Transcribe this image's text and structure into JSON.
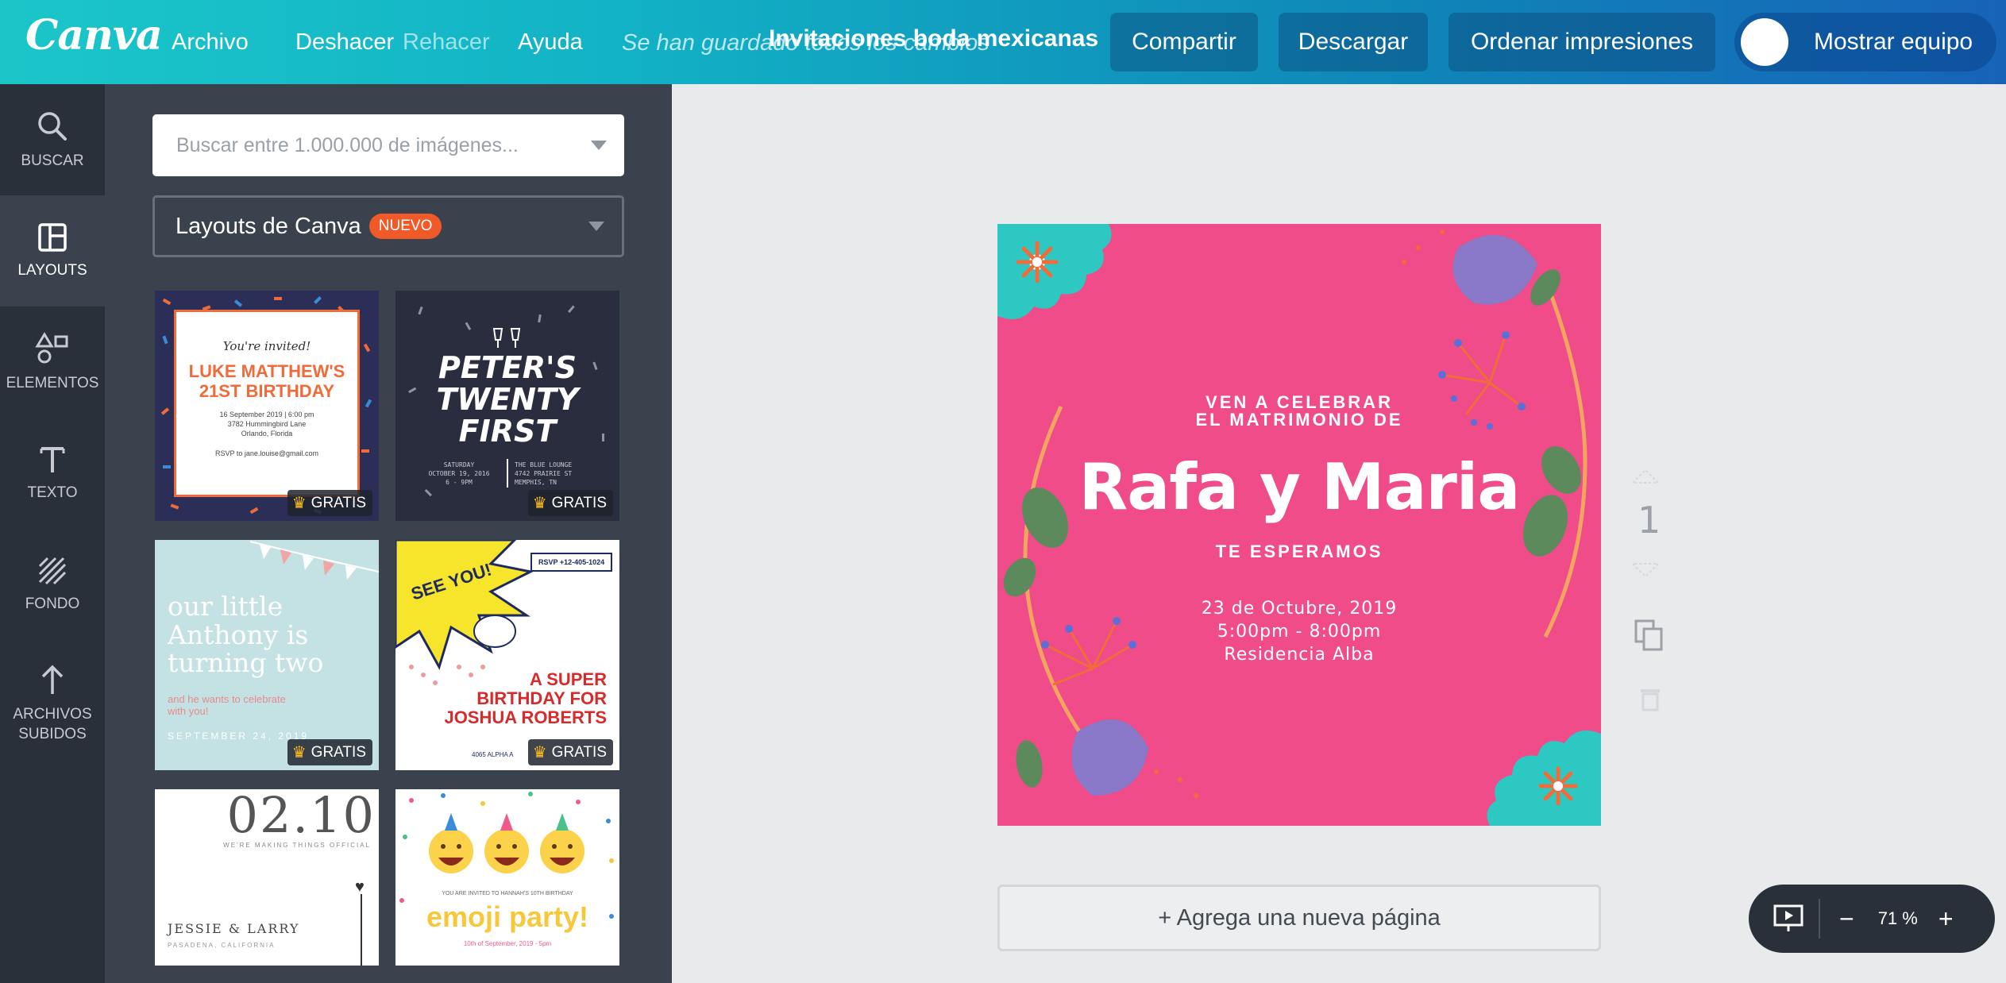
{
  "app": {
    "logo": "Canva"
  },
  "menu": {
    "file": "Archivo",
    "undo": "Deshacer",
    "redo": "Rehacer",
    "help": "Ayuda"
  },
  "saved_status": "Se han guardado todos los cambios",
  "document_title": "Invitaciones boda mexicanas",
  "toolbar": {
    "share": "Compartir",
    "download": "Descargar",
    "order_prints": "Ordenar impresiones",
    "show_team": "Mostrar equipo"
  },
  "sidebar": {
    "items": [
      {
        "label": "BUSCAR",
        "icon": "search-icon"
      },
      {
        "label": "LAYOUTS",
        "icon": "layouts-icon",
        "active": true
      },
      {
        "label": "ELEMENTOS",
        "icon": "elements-icon"
      },
      {
        "label": "TEXTO",
        "icon": "text-icon"
      },
      {
        "label": "FONDO",
        "icon": "background-icon"
      },
      {
        "label": "ARCHIVOS\nSUBIDOS",
        "label_line1": "ARCHIVOS",
        "label_line2": "SUBIDOS",
        "icon": "upload-icon"
      }
    ]
  },
  "panel": {
    "search_placeholder": "Buscar entre 1.000.000 de imágenes...",
    "layout_select": "Layouts de Canva",
    "new_badge": "NUEVO",
    "free_label": "GRATIS",
    "thumbnails": [
      {
        "title": "LUKE MATTHEW'S 21ST BIRTHDAY",
        "kicker": "You're invited!",
        "details": [
          "16 September 2019 | 6:00 pm",
          "3782 Hummingbird Lane",
          "Orlando, Florida"
        ],
        "rsvp": "RSVP to jane.louise@gmail.com",
        "free": true
      },
      {
        "title_lines": [
          "PETER'S",
          "TWENTY",
          "FIRST"
        ],
        "left_info": [
          "SATURDAY",
          "OCTOBER 19, 2016",
          "6 - 9PM"
        ],
        "right_info": [
          "THE BLUE LOUNGE",
          "4742 PRAIRIE ST",
          "MEMPHIS, TN"
        ],
        "free": true
      },
      {
        "title_lines": [
          "our little",
          "Anthony is",
          "turning two"
        ],
        "subtitle": "and he wants to celebrate with you!",
        "date": "SEPTEMBER 24, 2019",
        "free": true
      },
      {
        "burst": "SEE YOU!",
        "rsvp": "RSVP +12-405-1024",
        "title_lines": [
          "A SUPER",
          "BIRTHDAY FOR",
          "JOSHUA ROBERTS"
        ],
        "address_partial": "4065 ALPHA A",
        "free": true
      },
      {
        "date": "02.10",
        "tagline": "WE'RE MAKING THINGS OFFICIAL",
        "names": "JESSIE & LARRY",
        "place": "PASADENA, CALIFORNIA"
      },
      {
        "invite_line": "YOU ARE INVITED TO HANNAH'S 10TH BIRTHDAY",
        "title": "emoji party!",
        "date": "10th of September, 2019 - 5pm"
      }
    ]
  },
  "invitation": {
    "line1": "VEN A CELEBRAR",
    "line2": "EL MATRIMONIO DE",
    "names": "Rafa y Maria",
    "tagline": "TE ESPERAMOS",
    "date": "23 de Octubre, 2019",
    "time": "5:00pm - 8:00pm",
    "place": "Residencia Alba",
    "colors": {
      "background": "#ef4c89",
      "accent": "#2ec8c2",
      "leaf": "#5c8a5c",
      "flower": "#8a78c8"
    }
  },
  "page_number": "1",
  "add_page": "+ Agrega una nueva página",
  "zoom": {
    "level": "71 %",
    "minus": "−",
    "plus": "+"
  }
}
